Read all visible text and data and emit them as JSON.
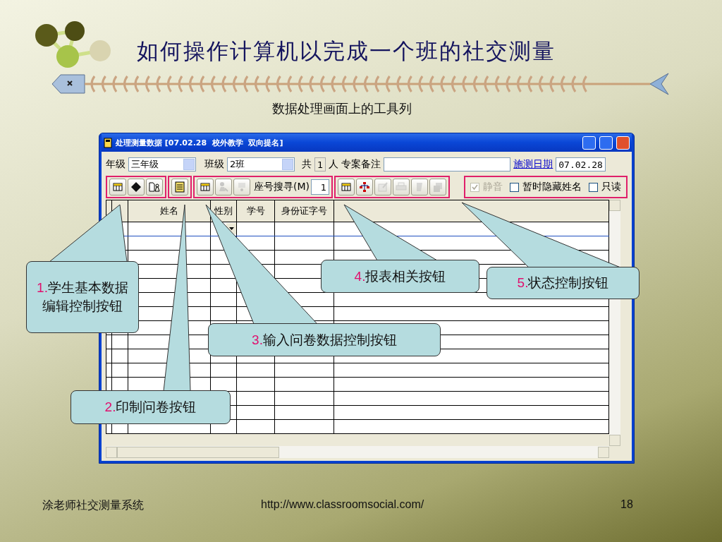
{
  "slide": {
    "title": "如何操作计算机以完成一个班的社交测量",
    "subtitle": "数据处理画面上的工具列"
  },
  "window": {
    "title": "处理测量数据 [07.02.28  校外教学  双向提名]"
  },
  "form": {
    "grade_label": "年级",
    "grade": "三年级",
    "class_label": "班级",
    "class": "2班",
    "total_label": "共",
    "total": "1",
    "person_unit": "人",
    "note_label": "专案备注",
    "date_link": "施测日期",
    "date": "07.02.28"
  },
  "toolbar": {
    "groups": [
      {
        "items": [
          {
            "kind": "button",
            "disabled": false
          },
          {
            "kind": "button",
            "disabled": false
          },
          {
            "kind": "button",
            "disabled": false
          }
        ]
      },
      {
        "items": [
          {
            "kind": "button",
            "disabled": false
          }
        ]
      },
      {
        "items": [
          {
            "kind": "button",
            "disabled": false
          },
          {
            "kind": "button",
            "disabled": true
          },
          {
            "kind": "button",
            "disabled": true
          },
          {
            "kind": "search",
            "label": "座号搜寻(M)",
            "value": "1"
          }
        ]
      },
      {
        "items": [
          {
            "kind": "button",
            "disabled": false
          },
          {
            "kind": "button",
            "disabled": false
          },
          {
            "kind": "button",
            "disabled": true
          },
          {
            "kind": "button",
            "disabled": true
          },
          {
            "kind": "button",
            "disabled": true
          },
          {
            "kind": "button",
            "disabled": true
          }
        ]
      },
      {
        "items": [
          {
            "kind": "checkbox",
            "label": "静音",
            "checked": true,
            "disabled": true
          },
          {
            "kind": "checkbox",
            "label": "暂时隐藏姓名",
            "checked": false,
            "disabled": false
          },
          {
            "kind": "checkbox",
            "label": "只读",
            "checked": false,
            "disabled": false
          }
        ]
      }
    ]
  },
  "table": {
    "columns": [
      "姓名",
      "性别",
      "学号",
      "身份证字号"
    ],
    "rows": [
      {
        "selected": true
      },
      {
        "selected": false
      },
      {
        "selected": false
      },
      {
        "selected": false
      },
      {
        "selected": false
      },
      {
        "selected": false
      },
      {
        "selected": false
      },
      {
        "selected": false
      },
      {
        "selected": false
      },
      {
        "selected": false
      },
      {
        "selected": false
      },
      {
        "selected": false
      },
      {
        "selected": false
      },
      {
        "selected": false
      },
      {
        "selected": false
      }
    ]
  },
  "callouts": [
    {
      "number": "1.",
      "text": "学生基本数据编辑控制按钮"
    },
    {
      "number": "2.",
      "text": "印制问卷按钮"
    },
    {
      "number": "3.",
      "text": "输入问卷数据控制按钮"
    },
    {
      "number": "4.",
      "text": "报表相关按钮"
    },
    {
      "number": "5.",
      "text": "状态控制按钮"
    }
  ],
  "footer": {
    "left": "涂老师社交测量系统",
    "url": "http://www.classroomsocial.com/",
    "page": "18"
  }
}
